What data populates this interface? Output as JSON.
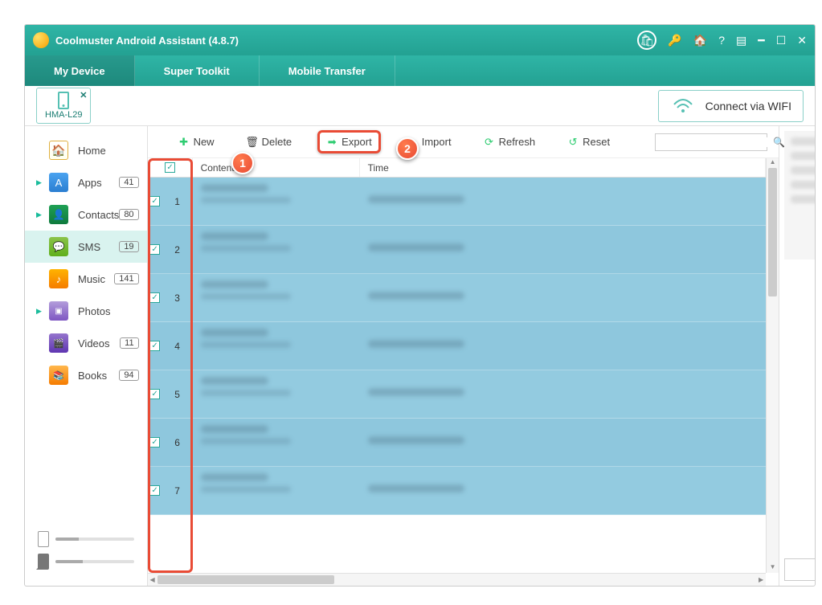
{
  "app": {
    "title": "Coolmuster Android Assistant (4.8.7)"
  },
  "tabs": {
    "my_device": "My Device",
    "super_toolkit": "Super Toolkit",
    "mobile_transfer": "Mobile Transfer"
  },
  "device": {
    "name": "HMA-L29"
  },
  "connect_wifi": "Connect via WIFI",
  "sidebar": {
    "items": [
      {
        "label": "Home",
        "badge": "",
        "icon": "home",
        "expand": false
      },
      {
        "label": "Apps",
        "badge": "41",
        "icon": "apps",
        "expand": true
      },
      {
        "label": "Contacts",
        "badge": "80",
        "icon": "contacts",
        "expand": true
      },
      {
        "label": "SMS",
        "badge": "19",
        "icon": "sms",
        "expand": false
      },
      {
        "label": "Music",
        "badge": "141",
        "icon": "music",
        "expand": false
      },
      {
        "label": "Photos",
        "badge": "",
        "icon": "photos",
        "expand": true
      },
      {
        "label": "Videos",
        "badge": "11",
        "icon": "videos",
        "expand": false
      },
      {
        "label": "Books",
        "badge": "94",
        "icon": "books",
        "expand": false
      }
    ]
  },
  "toolbar": {
    "new": "New",
    "delete": "Delete",
    "export": "Export",
    "import": "Import",
    "refresh": "Refresh",
    "reset": "Reset"
  },
  "columns": {
    "content": "Content",
    "time": "Time"
  },
  "rows": [
    {
      "n": "1"
    },
    {
      "n": "2"
    },
    {
      "n": "3"
    },
    {
      "n": "4"
    },
    {
      "n": "5"
    },
    {
      "n": "6"
    },
    {
      "n": "7"
    }
  ],
  "storage": {
    "phone_pct": 30,
    "sd_pct": 35
  },
  "callouts": {
    "c1": "1",
    "c2": "2"
  }
}
